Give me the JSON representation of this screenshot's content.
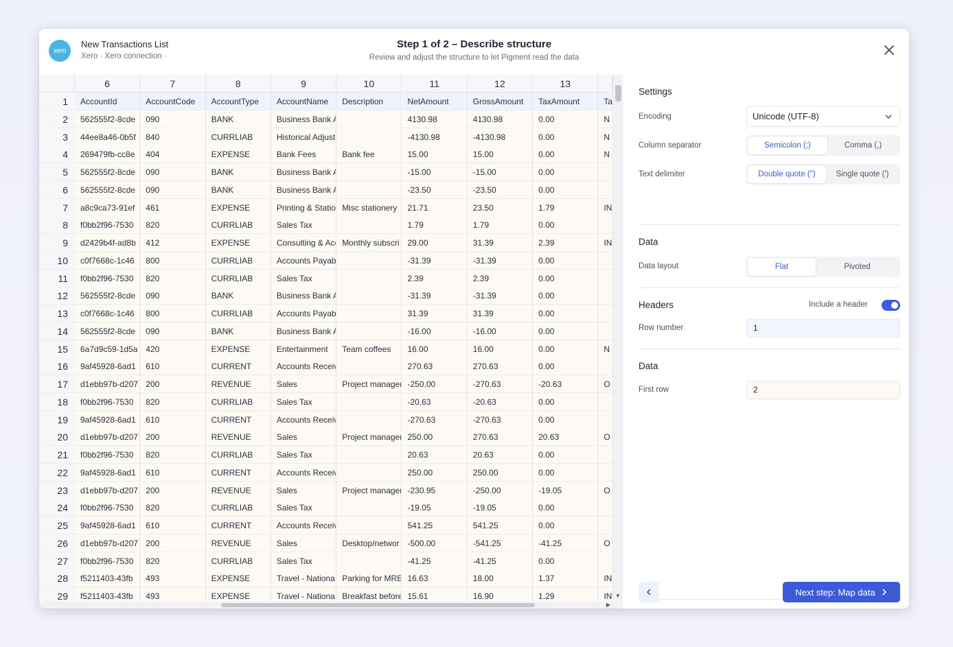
{
  "header": {
    "logo_text": "xero",
    "source_title": "New Transactions List",
    "source_subtitle": "Xero · Xero connection ·",
    "step_title": "Step 1 of 2 – Describe structure",
    "step_subtitle": "Review and adjust the structure to let Pigment read the data"
  },
  "grid": {
    "column_numbers": [
      "6",
      "7",
      "8",
      "9",
      "10",
      "11",
      "12",
      "13"
    ],
    "row_prefix_chars": [
      "",
      "2",
      "c",
      "3",
      "e",
      "e",
      "7",
      "8",
      "9",
      "c",
      "8",
      "5",
      "c",
      "5",
      "6",
      "5",
      "c",
      "8",
      "5",
      "c",
      "8",
      "7",
      "c",
      "8",
      "4",
      "c",
      "8",
      "t",
      "e"
    ],
    "extra_col_chars": [
      "Ta",
      "N",
      "N",
      "N",
      "",
      "",
      "IN",
      "",
      "IN",
      "",
      "",
      "",
      "",
      "",
      "N",
      "",
      "O",
      "",
      "",
      "O",
      "",
      "",
      "O",
      "",
      "",
      "O",
      "",
      "IN",
      "IN"
    ],
    "rows": [
      {
        "n": "1",
        "cells": [
          "AccountId",
          "AccountCode",
          "AccountType",
          "AccountName",
          "Description",
          "NetAmount",
          "GrossAmount",
          "TaxAmount"
        ]
      },
      {
        "n": "2",
        "cells": [
          "562555f2-8cde",
          "090",
          "BANK",
          "Business Bank A",
          "",
          "4130.98",
          "4130.98",
          "0.00"
        ]
      },
      {
        "n": "3",
        "cells": [
          "44ee8a46-0b5f",
          "840",
          "CURRLIAB",
          "Historical Adjust",
          "",
          "-4130.98",
          "-4130.98",
          "0.00"
        ]
      },
      {
        "n": "4",
        "cells": [
          "269479fb-cc8e",
          "404",
          "EXPENSE",
          "Bank Fees",
          "Bank fee",
          "15.00",
          "15.00",
          "0.00"
        ]
      },
      {
        "n": "5",
        "cells": [
          "562555f2-8cde",
          "090",
          "BANK",
          "Business Bank A",
          "",
          "-15.00",
          "-15.00",
          "0.00"
        ]
      },
      {
        "n": "6",
        "cells": [
          "562555f2-8cde",
          "090",
          "BANK",
          "Business Bank A",
          "",
          "-23.50",
          "-23.50",
          "0.00"
        ]
      },
      {
        "n": "7",
        "cells": [
          "a8c9ca73-91ef",
          "461",
          "EXPENSE",
          "Printing & Statio",
          "Misc stationery",
          "21.71",
          "23.50",
          "1.79"
        ]
      },
      {
        "n": "8",
        "cells": [
          "f0bb2f96-7530",
          "820",
          "CURRLIAB",
          "Sales Tax",
          "",
          "1.79",
          "1.79",
          "0.00"
        ]
      },
      {
        "n": "9",
        "cells": [
          "d2429b4f-ad8b",
          "412",
          "EXPENSE",
          "Consulting & Acc",
          "Monthly subscri",
          "29.00",
          "31.39",
          "2.39"
        ]
      },
      {
        "n": "10",
        "cells": [
          "c0f7668c-1c46",
          "800",
          "CURRLIAB",
          "Accounts Payab",
          "",
          "-31.39",
          "-31.39",
          "0.00"
        ]
      },
      {
        "n": "11",
        "cells": [
          "f0bb2f96-7530",
          "820",
          "CURRLIAB",
          "Sales Tax",
          "",
          "2.39",
          "2.39",
          "0.00"
        ]
      },
      {
        "n": "12",
        "cells": [
          "562555f2-8cde",
          "090",
          "BANK",
          "Business Bank A",
          "",
          "-31.39",
          "-31.39",
          "0.00"
        ]
      },
      {
        "n": "13",
        "cells": [
          "c0f7668c-1c46",
          "800",
          "CURRLIAB",
          "Accounts Payab",
          "",
          "31.39",
          "31.39",
          "0.00"
        ]
      },
      {
        "n": "14",
        "cells": [
          "562555f2-8cde",
          "090",
          "BANK",
          "Business Bank A",
          "",
          "-16.00",
          "-16.00",
          "0.00"
        ]
      },
      {
        "n": "15",
        "cells": [
          "6a7d9c59-1d5a",
          "420",
          "EXPENSE",
          "Entertainment",
          "Team coffees",
          "16.00",
          "16.00",
          "0.00"
        ]
      },
      {
        "n": "16",
        "cells": [
          "9af45928-6ad1",
          "610",
          "CURRENT",
          "Accounts Receiv",
          "",
          "270.63",
          "270.63",
          "0.00"
        ]
      },
      {
        "n": "17",
        "cells": [
          "d1ebb97b-d207",
          "200",
          "REVENUE",
          "Sales",
          "Project manager",
          "-250.00",
          "-270.63",
          "-20.63"
        ]
      },
      {
        "n": "18",
        "cells": [
          "f0bb2f96-7530",
          "820",
          "CURRLIAB",
          "Sales Tax",
          "",
          "-20.63",
          "-20.63",
          "0.00"
        ]
      },
      {
        "n": "19",
        "cells": [
          "9af45928-6ad1",
          "610",
          "CURRENT",
          "Accounts Receiv",
          "",
          "-270.63",
          "-270.63",
          "0.00"
        ]
      },
      {
        "n": "20",
        "cells": [
          "d1ebb97b-d207",
          "200",
          "REVENUE",
          "Sales",
          "Project manager",
          "250.00",
          "270.63",
          "20.63"
        ]
      },
      {
        "n": "21",
        "cells": [
          "f0bb2f96-7530",
          "820",
          "CURRLIAB",
          "Sales Tax",
          "",
          "20.63",
          "20.63",
          "0.00"
        ]
      },
      {
        "n": "22",
        "cells": [
          "9af45928-6ad1",
          "610",
          "CURRENT",
          "Accounts Receiv",
          "",
          "250.00",
          "250.00",
          "0.00"
        ]
      },
      {
        "n": "23",
        "cells": [
          "d1ebb97b-d207",
          "200",
          "REVENUE",
          "Sales",
          "Project manager",
          "-230.95",
          "-250.00",
          "-19.05"
        ]
      },
      {
        "n": "24",
        "cells": [
          "f0bb2f96-7530",
          "820",
          "CURRLIAB",
          "Sales Tax",
          "",
          "-19.05",
          "-19.05",
          "0.00"
        ]
      },
      {
        "n": "25",
        "cells": [
          "9af45928-6ad1",
          "610",
          "CURRENT",
          "Accounts Receiv",
          "",
          "541.25",
          "541.25",
          "0.00"
        ]
      },
      {
        "n": "26",
        "cells": [
          "d1ebb97b-d207",
          "200",
          "REVENUE",
          "Sales",
          "Desktop/networ",
          "-500.00",
          "-541.25",
          "-41.25"
        ]
      },
      {
        "n": "27",
        "cells": [
          "f0bb2f96-7530",
          "820",
          "CURRLIAB",
          "Sales Tax",
          "",
          "-41.25",
          "-41.25",
          "0.00"
        ]
      },
      {
        "n": "28",
        "cells": [
          "f5211403-43fb",
          "493",
          "EXPENSE",
          "Travel - Nationa",
          "Parking for MRE",
          "16.63",
          "18.00",
          "1.37"
        ]
      },
      {
        "n": "29",
        "cells": [
          "f5211403-43fb",
          "493",
          "EXPENSE",
          "Travel - Nationa",
          "Breakfast before",
          "15.61",
          "16.90",
          "1.29"
        ]
      }
    ]
  },
  "settings": {
    "title": "Settings",
    "encoding_label": "Encoding",
    "encoding_value": "Unicode (UTF-8)",
    "separator_label": "Column separator",
    "separator_options": [
      "Semicolon (;)",
      "Comma (,)"
    ],
    "delimiter_label": "Text delimiter",
    "delimiter_options": [
      "Double quote (\")",
      "Single quote (')"
    ]
  },
  "data_section": {
    "title": "Data",
    "layout_label": "Data layout",
    "layout_options": [
      "Flat",
      "Pivoted"
    ]
  },
  "headers_section": {
    "title": "Headers",
    "toggle_label": "Include a header",
    "toggle_on": true,
    "row_number_label": "Row number",
    "row_number_value": "1"
  },
  "data_rows_section": {
    "title": "Data",
    "first_row_label": "First row",
    "first_row_value": "2"
  },
  "footer": {
    "next_label": "Next step: Map data"
  },
  "colors": {
    "accent": "#3d5bd9",
    "xero": "#4ab5e3",
    "header_row": "#eef4fd",
    "data_cell": "#fdf9f5"
  }
}
